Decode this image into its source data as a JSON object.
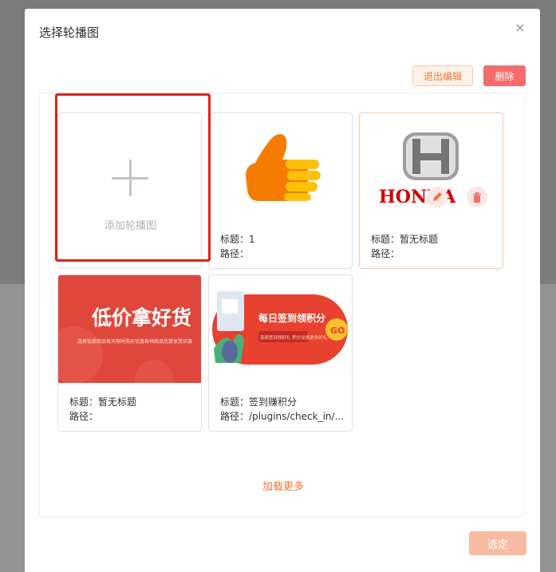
{
  "dialog": {
    "title": "选择轮播图",
    "close_icon": "×"
  },
  "toolbar": {
    "exit_edit_label": "退出编辑",
    "delete_label": "删除"
  },
  "add_card": {
    "label": "添加轮播图"
  },
  "cards": [
    {
      "title": "标题：1",
      "path": "路径：",
      "image": "thumbs-up-icon"
    },
    {
      "title": "标题：暂无标题",
      "path": "路径：",
      "image": "honda-logo",
      "brand_text": "HONDA"
    },
    {
      "title": "标题：暂无标题",
      "path": "路径：",
      "image": "low-price-banner",
      "banner_text": "低价拿好货",
      "banner_sub": "选择优质商品每天限时购买优惠各种商品优惠享受实惠"
    },
    {
      "title": "标题：签到赚积分",
      "path": "路径：/plugins/check_in/...",
      "image": "check-in-banner",
      "banner_text": "每日签到领积分",
      "banner_sub": "连续签到领好礼 积分兑换更多好礼",
      "go_text": "GO"
    }
  ],
  "load_more_label": "加载更多",
  "confirm_label": "选定",
  "colors": {
    "accent": "#ee7630",
    "danger": "#f56c6c",
    "highlight": "#e0221b"
  }
}
